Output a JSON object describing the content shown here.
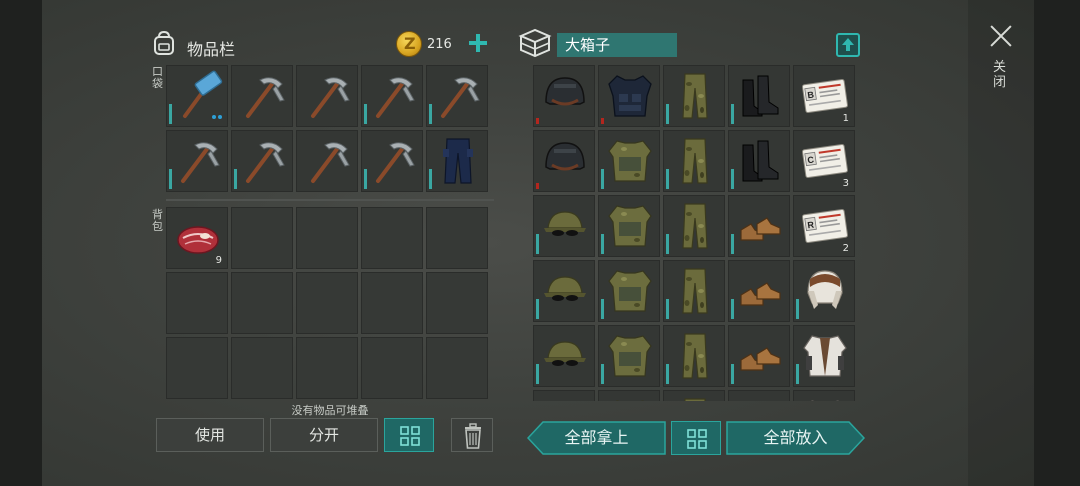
{
  "inventory": {
    "title": "物品栏",
    "coins": "216",
    "pocket_label": "口袋",
    "backpack_label": "背包",
    "pocket_slots": [
      {
        "item": "sledgehammer",
        "bar": "teal",
        "badge": "dots"
      },
      {
        "item": "pickaxe",
        "bar": "none"
      },
      {
        "item": "pickaxe",
        "bar": "none"
      },
      {
        "item": "pickaxe",
        "bar": "teal"
      },
      {
        "item": "pickaxe",
        "bar": "teal"
      },
      {
        "item": "pickaxe",
        "bar": "teal"
      },
      {
        "item": "pickaxe",
        "bar": "teal"
      },
      {
        "item": "pickaxe",
        "bar": "none"
      },
      {
        "item": "pickaxe",
        "bar": "teal"
      },
      {
        "item": "police-pants",
        "bar": "teal"
      }
    ],
    "backpack_slots": [
      {
        "item": "raw-steak",
        "count": "9"
      },
      {
        "item": ""
      },
      {
        "item": ""
      },
      {
        "item": ""
      },
      {
        "item": ""
      },
      {
        "item": ""
      },
      {
        "item": ""
      },
      {
        "item": ""
      },
      {
        "item": ""
      },
      {
        "item": ""
      },
      {
        "item": ""
      },
      {
        "item": ""
      },
      {
        "item": ""
      },
      {
        "item": ""
      },
      {
        "item": ""
      }
    ],
    "no_stack_text": "没有物品可堆叠",
    "use_label": "使用",
    "split_label": "分开"
  },
  "container": {
    "name": "大箱子",
    "take_all_label": "全部拿上",
    "put_all_label": "全部放入",
    "slots": [
      {
        "item": "helmet",
        "bar": "red"
      },
      {
        "item": "police-vest",
        "bar": "red"
      },
      {
        "item": "camo-pants",
        "bar": "teal"
      },
      {
        "item": "boots",
        "bar": "teal"
      },
      {
        "item": "id-card",
        "letter": "B",
        "count": "1"
      },
      {
        "item": "helmet",
        "bar": "red"
      },
      {
        "item": "camo-jacket",
        "bar": "teal"
      },
      {
        "item": "camo-pants",
        "bar": "teal"
      },
      {
        "item": "boots",
        "bar": "teal"
      },
      {
        "item": "id-card",
        "letter": "C",
        "count": "3"
      },
      {
        "item": "camo-cap",
        "bar": "teal"
      },
      {
        "item": "camo-jacket",
        "bar": "teal"
      },
      {
        "item": "camo-pants",
        "bar": "teal"
      },
      {
        "item": "shoes",
        "bar": "teal"
      },
      {
        "item": "id-card",
        "letter": "R",
        "count": "2"
      },
      {
        "item": "camo-cap",
        "bar": "teal"
      },
      {
        "item": "camo-jacket",
        "bar": "teal"
      },
      {
        "item": "camo-pants",
        "bar": "teal"
      },
      {
        "item": "shoes",
        "bar": "teal"
      },
      {
        "item": "aviator-hat",
        "bar": "teal"
      },
      {
        "item": "camo-cap",
        "bar": "teal"
      },
      {
        "item": "camo-jacket",
        "bar": "teal"
      },
      {
        "item": "camo-pants",
        "bar": "teal"
      },
      {
        "item": "shoes",
        "bar": "teal"
      },
      {
        "item": "leather-jacket",
        "bar": "teal"
      },
      {
        "item": "camo-cap",
        "bar": "teal"
      },
      {
        "item": "camo-jacket",
        "bar": "teal"
      },
      {
        "item": "camo-pants",
        "bar": "teal"
      },
      {
        "item": "shoes",
        "bar": "teal"
      },
      {
        "item": "leather-jacket",
        "bar": "teal"
      }
    ]
  },
  "close_label": "关闭",
  "colors": {
    "accent": "#2fb8b0",
    "durability_good": "#3aa7a2",
    "durability_low": "#b3261e",
    "card_red": "#c0392b"
  }
}
